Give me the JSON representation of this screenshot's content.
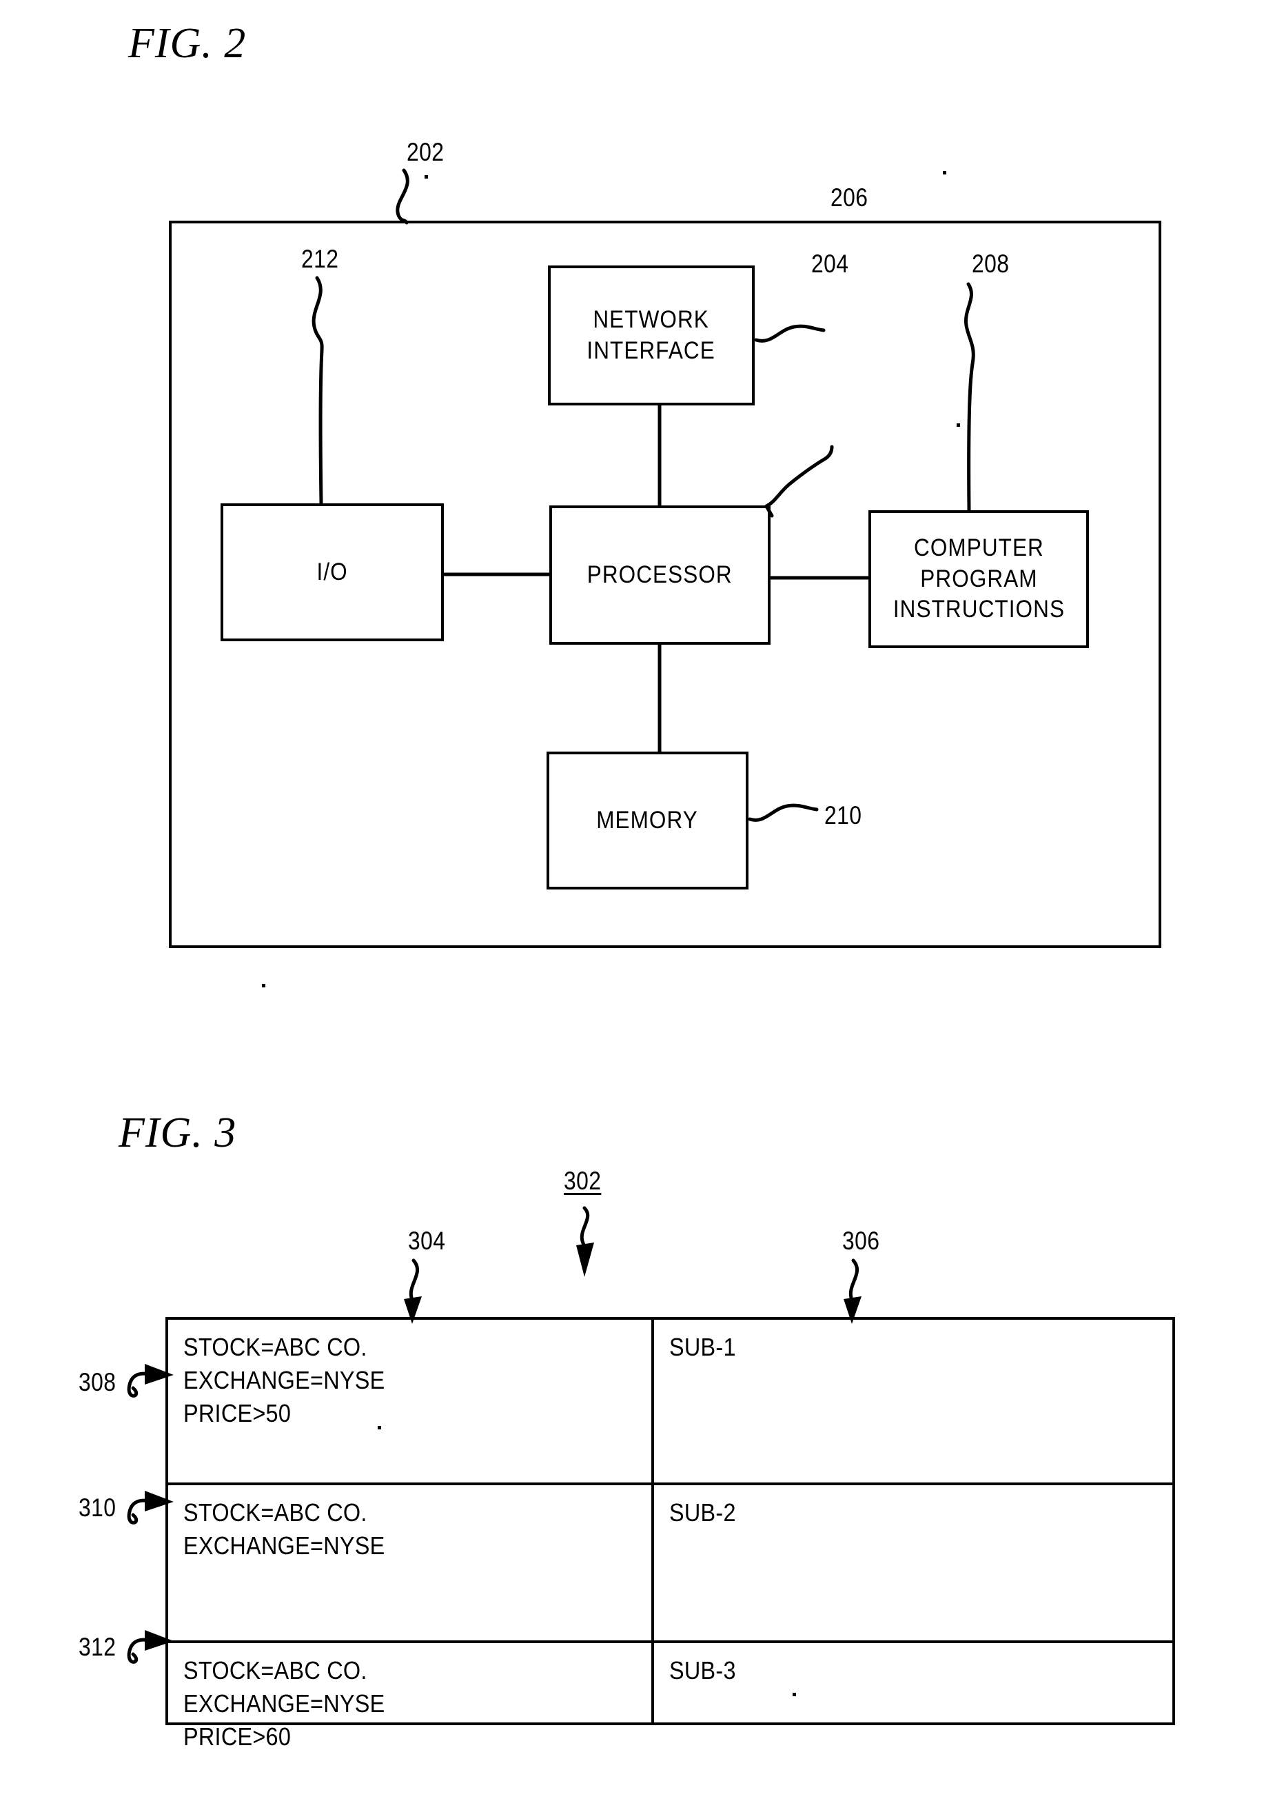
{
  "figures": [
    {
      "title": "FIG. 2",
      "diagram_number": "202",
      "blocks": [
        {
          "id": "network-interface",
          "label": "NETWORK\nINTERFACE",
          "ref": "206"
        },
        {
          "id": "io",
          "label": "I/O",
          "ref": "212"
        },
        {
          "id": "processor",
          "label": "PROCESSOR",
          "ref": "204"
        },
        {
          "id": "computer-program-instructions",
          "label": "COMPUTER\nPROGRAM\nINSTRUCTIONS",
          "ref": "208"
        },
        {
          "id": "memory",
          "label": "MEMORY",
          "ref": "210"
        }
      ],
      "refs": {
        "outer": "202",
        "processor": "204",
        "network_interface": "206",
        "computer_program_instructions": "208",
        "memory": "210",
        "io": "212"
      },
      "block_labels": {
        "network_interface_line1": "NETWORK",
        "network_interface_line2": "INTERFACE",
        "io": "I/O",
        "processor": "PROCESSOR",
        "cpi_line1": "COMPUTER",
        "cpi_line2": "PROGRAM",
        "cpi_line3": "INSTRUCTIONS",
        "memory": "MEMORY"
      }
    },
    {
      "title": "FIG. 3",
      "diagram_number": "302",
      "column_refs": {
        "left": "304",
        "right": "306"
      },
      "row_refs": {
        "row1": "308",
        "row2": "310",
        "row3": "312"
      },
      "table": {
        "ref": "302",
        "rows": [
          {
            "ref": "308",
            "criteria": [
              "STOCK=ABC CO.",
              "EXCHANGE=NYSE",
              "PRICE>50"
            ],
            "subscriber": "SUB-1"
          },
          {
            "ref": "310",
            "criteria": [
              "STOCK=ABC CO.",
              "EXCHANGE=NYSE"
            ],
            "subscriber": "SUB-2"
          },
          {
            "ref": "312",
            "criteria": [
              "STOCK=ABC CO.",
              "EXCHANGE=NYSE",
              "PRICE>60"
            ],
            "subscriber": "SUB-3"
          }
        ]
      }
    }
  ],
  "colors": {
    "ink": "#000000",
    "paper": "#ffffff"
  }
}
